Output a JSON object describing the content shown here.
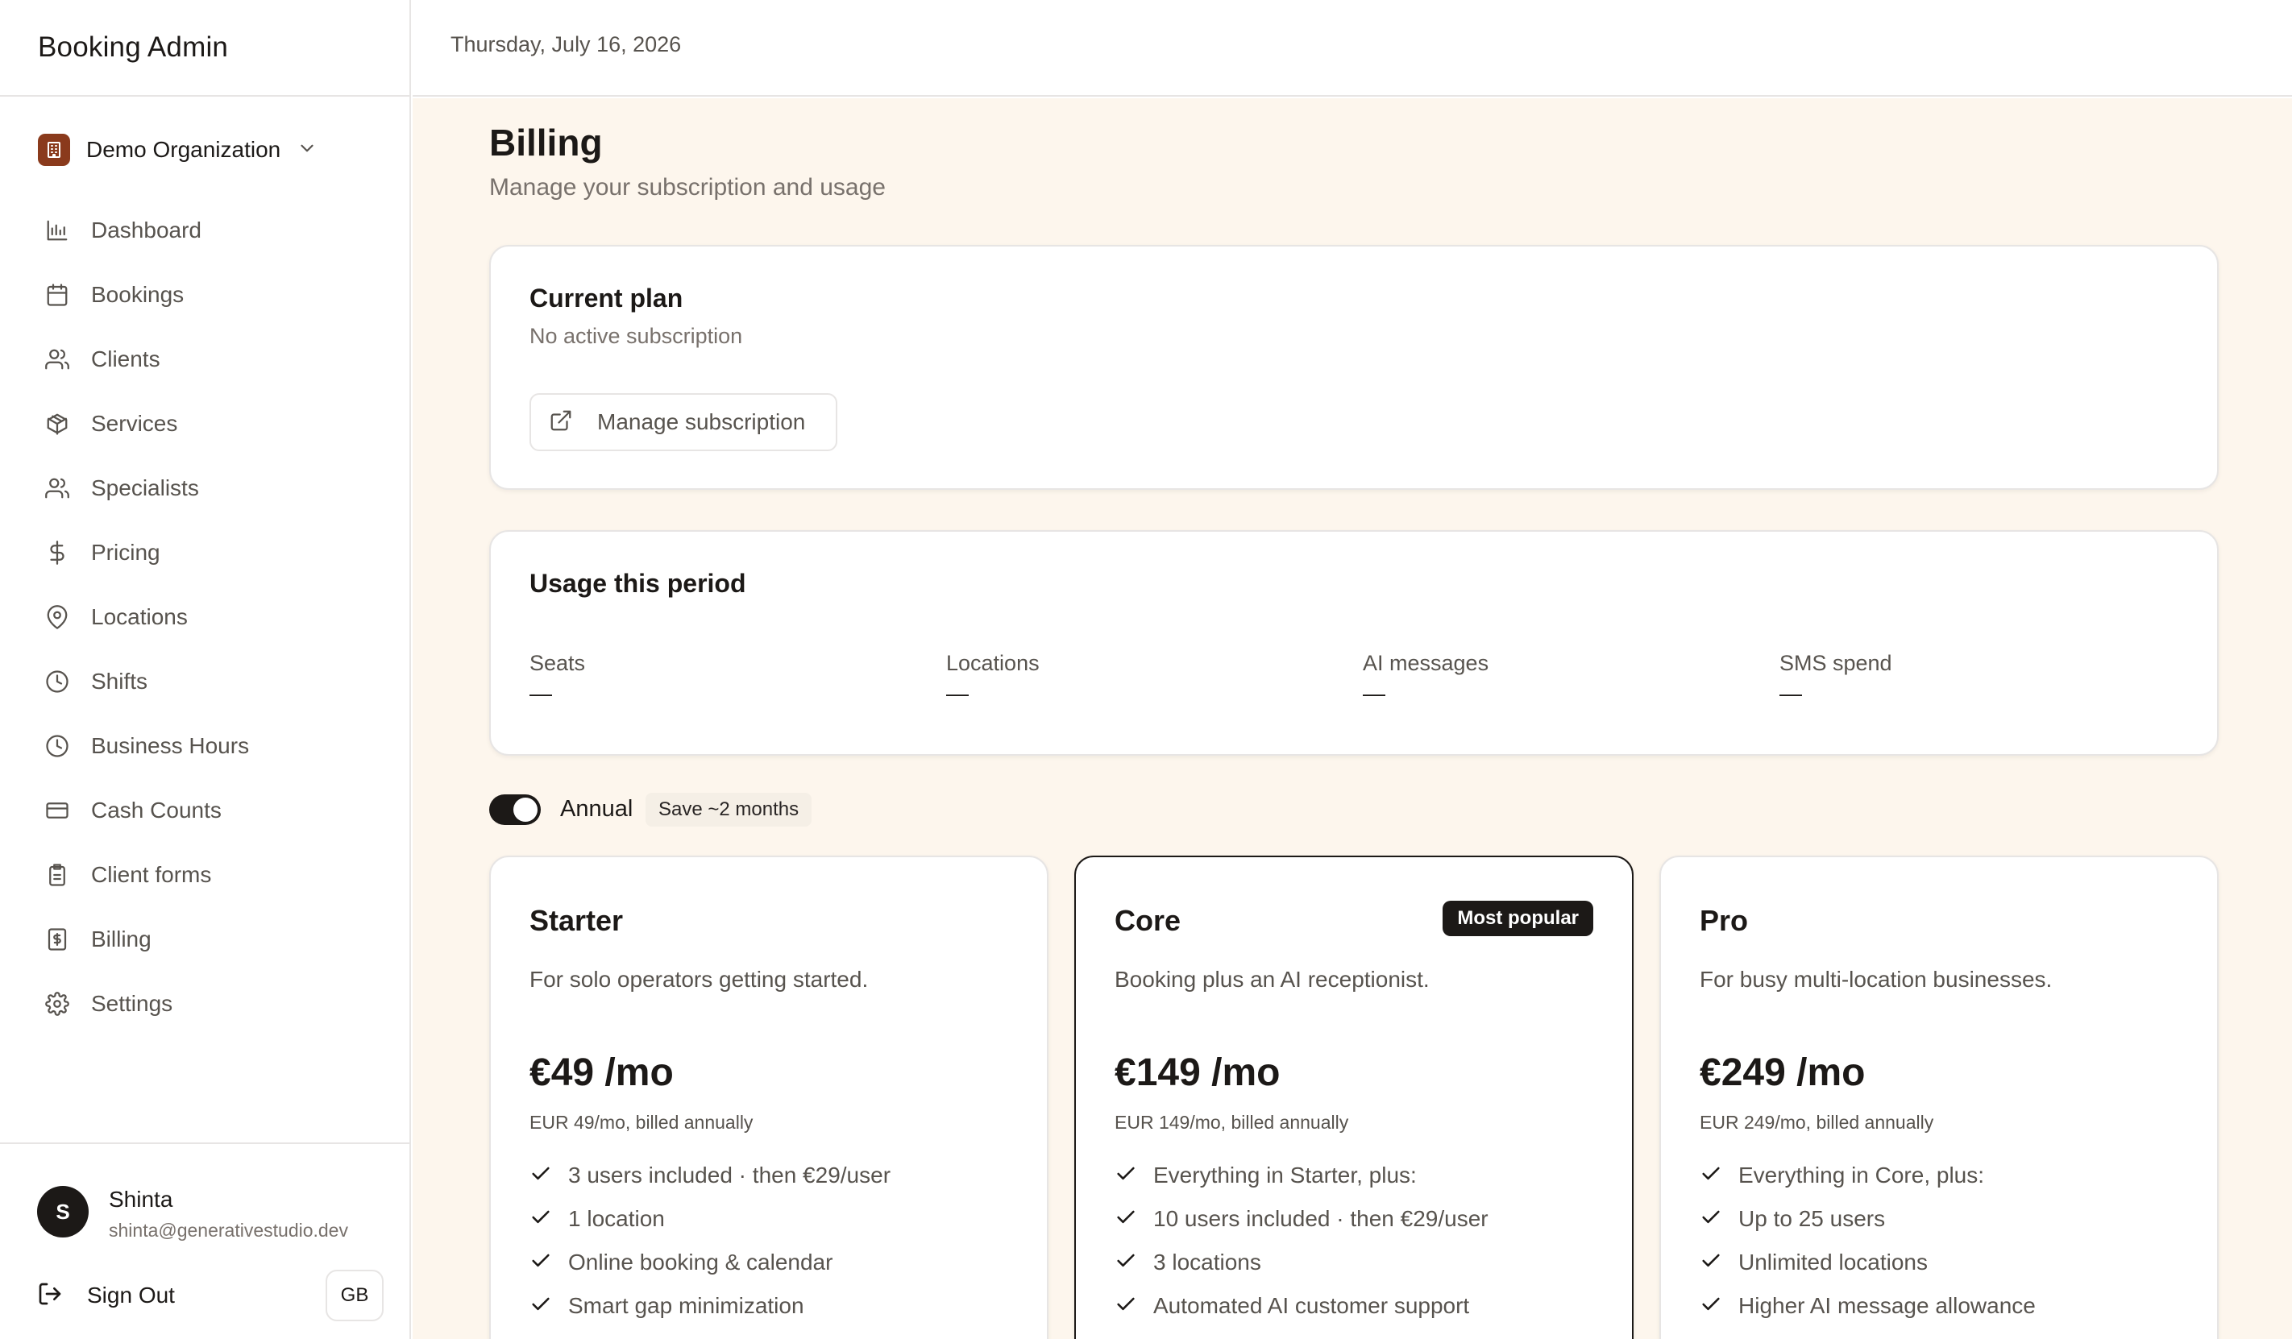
{
  "app": {
    "title": "Booking Admin"
  },
  "org": {
    "name": "Demo Organization",
    "icon": "building-icon"
  },
  "nav": [
    {
      "label": "Dashboard",
      "icon": "bar-chart-icon"
    },
    {
      "label": "Bookings",
      "icon": "calendar-icon"
    },
    {
      "label": "Clients",
      "icon": "users-icon"
    },
    {
      "label": "Services",
      "icon": "package-icon"
    },
    {
      "label": "Specialists",
      "icon": "users-icon"
    },
    {
      "label": "Pricing",
      "icon": "dollar-icon"
    },
    {
      "label": "Locations",
      "icon": "map-pin-icon"
    },
    {
      "label": "Shifts",
      "icon": "clock-icon"
    },
    {
      "label": "Business Hours",
      "icon": "clock-icon"
    },
    {
      "label": "Cash Counts",
      "icon": "credit-card-icon"
    },
    {
      "label": "Client forms",
      "icon": "clipboard-icon"
    },
    {
      "label": "Billing",
      "icon": "receipt-icon"
    },
    {
      "label": "Settings",
      "icon": "gear-icon"
    }
  ],
  "user": {
    "initial": "S",
    "name": "Shinta",
    "email": "shinta@generativestudio.dev",
    "sign_out_label": "Sign Out",
    "language": "GB"
  },
  "header": {
    "date": "Thursday, July 16, 2026"
  },
  "page": {
    "title": "Billing",
    "subtitle": "Manage your subscription and usage"
  },
  "current_plan": {
    "title": "Current plan",
    "status": "No active subscription",
    "manage_label": "Manage subscription"
  },
  "usage": {
    "title": "Usage this period",
    "items": [
      {
        "label": "Seats",
        "value": "—"
      },
      {
        "label": "Locations",
        "value": "—"
      },
      {
        "label": "AI messages",
        "value": "—"
      },
      {
        "label": "SMS spend",
        "value": "—"
      }
    ]
  },
  "billing_toggle": {
    "label": "Annual",
    "enabled": true,
    "badge": "Save ~2 months"
  },
  "plans": [
    {
      "name": "Starter",
      "description": "For solo operators getting started.",
      "price": "€49 /mo",
      "note": "EUR 49/mo, billed annually",
      "features": [
        "3 users included · then €29/user",
        "1 location",
        "Online booking & calendar",
        "Smart gap minimization"
      ]
    },
    {
      "name": "Core",
      "badge": "Most popular",
      "description": "Booking plus an AI receptionist.",
      "price": "€149 /mo",
      "note": "EUR 149/mo, billed annually",
      "features": [
        "Everything in Starter, plus:",
        "10 users included · then €29/user",
        "3 locations",
        "Automated AI customer support"
      ]
    },
    {
      "name": "Pro",
      "description": "For busy multi-location businesses.",
      "price": "€249 /mo",
      "note": "EUR 249/mo, billed annually",
      "features": [
        "Everything in Core, plus:",
        "Up to 25 users",
        "Unlimited locations",
        "Higher AI message allowance"
      ]
    }
  ],
  "colors": {
    "accent": "#1c1917",
    "page_background": "#fdf6ed",
    "org_logo": "#8a3a1c",
    "border": "#e7e5e4"
  }
}
